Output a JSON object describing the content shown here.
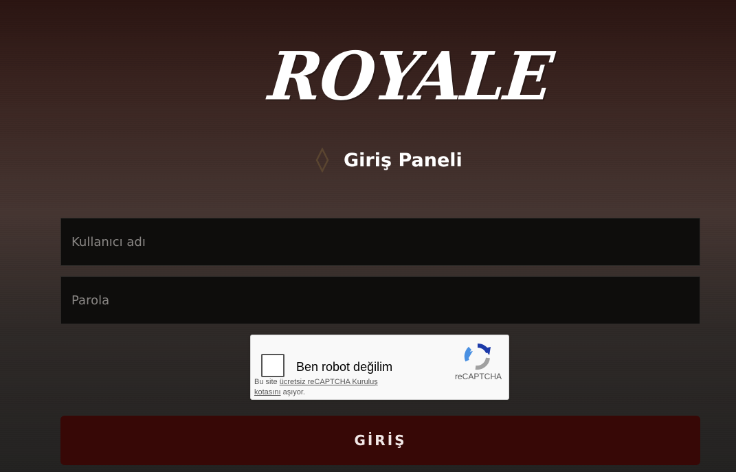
{
  "brand": {
    "logo_text": "ROYALE"
  },
  "panel": {
    "title": "Giriş Paneli"
  },
  "form": {
    "username_placeholder": "Kullanıcı adı",
    "password_placeholder": "Parola",
    "submit_label": "GİRİŞ"
  },
  "recaptcha": {
    "label": "Ben robot değilim",
    "brand": "reCAPTCHA",
    "note_prefix": "Bu site ",
    "note_link": "ücretsiz reCAPTCHA Kuruluş kotasını",
    "note_suffix": " aşıyor."
  },
  "colors": {
    "button_bg": "#370806",
    "field_bg": "#0e0d0c",
    "diamond_accent": "#5a4530"
  },
  "icons": {
    "heading": "diamond-icon",
    "captcha": "recaptcha-logo-icon"
  }
}
